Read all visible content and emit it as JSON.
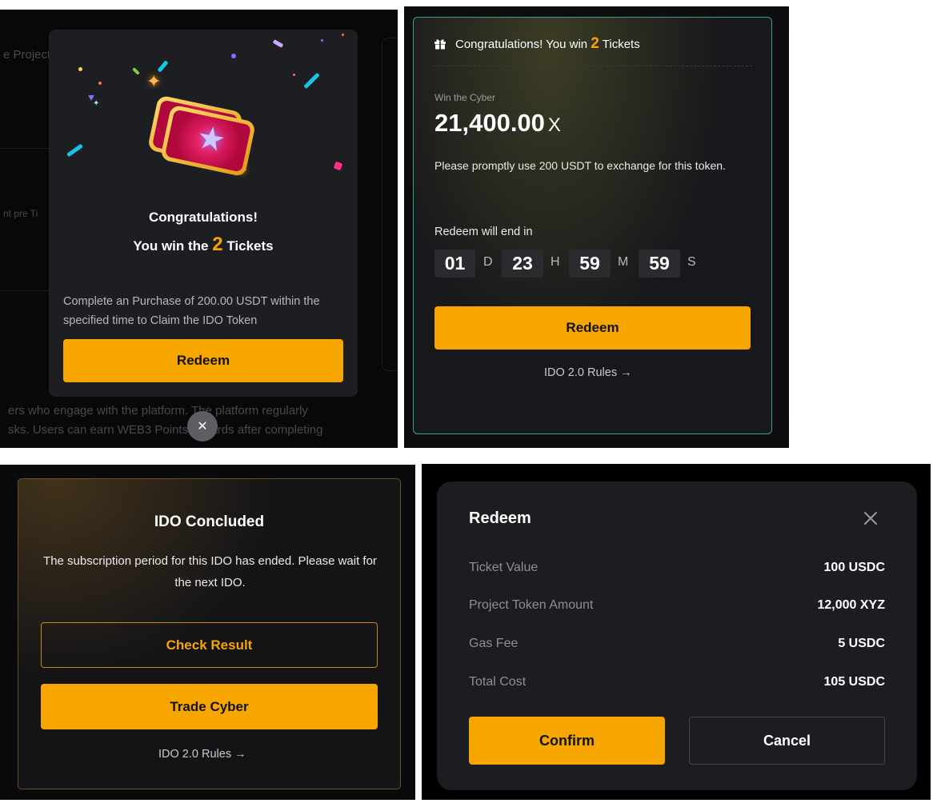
{
  "panel1": {
    "background": {
      "text_lines": [
        "e Project",
        "nt pre Ti",
        "ers who engage with the platform. The platform regularly",
        "sks. Users can earn WEB3 Points rewards after completing"
      ]
    },
    "modal": {
      "title": "Congratulations!",
      "subtitle_prefix": "You win the",
      "ticket_count": "2",
      "subtitle_suffix": "Tickets",
      "description": "Complete an Purchase of 200.00 USDT within the specified time to Claim the IDO Token",
      "redeem_label": "Redeem",
      "close_glyph": "✕"
    }
  },
  "panel2": {
    "header_prefix": "Congratulations! You win",
    "ticket_count": "2",
    "header_suffix": "Tickets",
    "label": "Win the Cyber",
    "amount": "21,400.00",
    "amount_unit": "X",
    "description": "Please promptly use 200 USDT to exchange for this token.",
    "countdown_label": "Redeem will end in",
    "countdown": {
      "days": "01",
      "days_unit": "D",
      "hours": "23",
      "hours_unit": "H",
      "minutes": "59",
      "minutes_unit": "M",
      "seconds": "59",
      "seconds_unit": "S"
    },
    "redeem_label": "Redeem",
    "rules_link": "IDO 2.0 Rules →"
  },
  "panel3": {
    "title": "IDO Concluded",
    "description": "The subscription period for this IDO has ended. Please wait  for the next IDO.",
    "check_result_label": "Check Result",
    "trade_label": "Trade Cyber",
    "rules_link": "IDO 2.0 Rules →"
  },
  "panel4": {
    "title": "Redeem",
    "rows": [
      {
        "label": "Ticket Value",
        "value": "100 USDC"
      },
      {
        "label": "Project Token Amount",
        "value": "12,000 XYZ"
      },
      {
        "label": "Gas Fee",
        "value": "5 USDC"
      },
      {
        "label": "Total Cost",
        "value": "105 USDC"
      }
    ],
    "confirm_label": "Confirm",
    "cancel_label": "Cancel"
  },
  "colors": {
    "accent": "#f7a600",
    "dark_bg": "#0d0d0f",
    "modal_bg": "#1d1e21",
    "border_teal": "#3c9e8a",
    "border_gold": "#6a5020"
  },
  "icons": [
    "gift-icon",
    "close-icon",
    "ticket-illustration",
    "sparkle-icon"
  ]
}
